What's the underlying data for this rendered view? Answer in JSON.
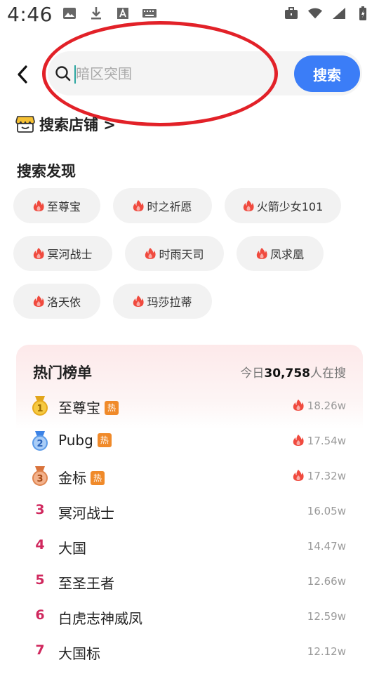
{
  "status_bar": {
    "time": "4:46",
    "left_icons": [
      "image-icon",
      "download-icon",
      "a-icon",
      "keyboard-icon"
    ],
    "right_icons": [
      "briefcase-icon",
      "wifi-icon",
      "signal-icon",
      "battery-icon"
    ]
  },
  "header": {
    "search_placeholder": "暗区突围",
    "search_button": "搜索"
  },
  "store": {
    "label": "搜索店铺 >"
  },
  "discover": {
    "title": "搜索发现",
    "chips": [
      "至尊宝",
      "时之祈愿",
      "火箭少女101",
      "冥河战士",
      "时雨天司",
      "凤求凰",
      "洛天依",
      "玛莎拉蒂"
    ]
  },
  "hot_list": {
    "title": "热门榜单",
    "count_prefix": "今日",
    "count_value": "30,758",
    "count_suffix": "人在搜",
    "badge": "热",
    "items": [
      {
        "rank": "1",
        "name": "至尊宝",
        "value": "18.26w"
      },
      {
        "rank": "2",
        "name": "Pubg",
        "value": "17.54w"
      },
      {
        "rank": "3",
        "name": "金标",
        "value": "17.32w"
      },
      {
        "rank": "3",
        "name": "冥河战士",
        "value": "16.05w"
      },
      {
        "rank": "4",
        "name": "大国",
        "value": "14.47w"
      },
      {
        "rank": "5",
        "name": "至圣王者",
        "value": "12.66w"
      },
      {
        "rank": "6",
        "name": "白虎志神威凤",
        "value": "12.59w"
      },
      {
        "rank": "7",
        "name": "大国标",
        "value": "12.12w"
      }
    ]
  },
  "colors": {
    "accent": "#3b7df7",
    "rank_number": "#d0285e",
    "fire": "#f04a3e",
    "hot_badge": "#f08a2a",
    "annotation": "#e22128"
  }
}
